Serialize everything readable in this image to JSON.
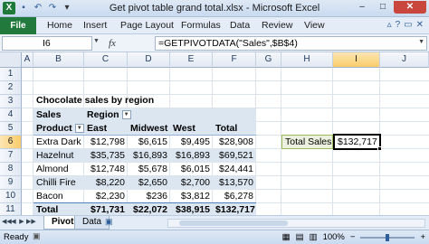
{
  "window": {
    "title": "Get pivot table grand total.xlsx - Microsoft Excel",
    "min": "–",
    "max": "□",
    "close": "✕"
  },
  "qat": {
    "logo": "X",
    "save": "▪",
    "undo": "↶",
    "redo": "↷",
    "more": "▾"
  },
  "ribbon": {
    "file": "File",
    "tabs": [
      "Home",
      "Insert",
      "Page Layout",
      "Formulas",
      "Data",
      "Review",
      "View"
    ],
    "help": "?"
  },
  "formula_bar": {
    "name_box": "I6",
    "fx": "fx",
    "formula": "=GETPIVOTDATA(\"Sales\",$B$4)"
  },
  "columns": [
    "A",
    "B",
    "C",
    "D",
    "E",
    "F",
    "G",
    "H",
    "I",
    "J"
  ],
  "rows": [
    "1",
    "2",
    "3",
    "4",
    "5",
    "6",
    "7",
    "8",
    "9",
    "10",
    "11",
    "12"
  ],
  "sheet": {
    "title": "Chocolate sales by region",
    "pivot": {
      "sales_label": "Sales",
      "region_label": "Region",
      "product_label": "Product",
      "headers": [
        "East",
        "Midwest",
        "West",
        "Total"
      ],
      "rows": [
        {
          "product": "Extra Dark",
          "values": [
            "$12,798",
            "$6,615",
            "$9,495",
            "$28,908"
          ]
        },
        {
          "product": "Hazelnut",
          "values": [
            "$35,735",
            "$16,893",
            "$16,893",
            "$69,521"
          ]
        },
        {
          "product": "Almond",
          "values": [
            "$12,748",
            "$5,678",
            "$6,015",
            "$24,441"
          ]
        },
        {
          "product": "Chilli Fire",
          "values": [
            "$8,220",
            "$2,650",
            "$2,700",
            "$13,570"
          ]
        },
        {
          "product": "Bacon",
          "values": [
            "$2,230",
            "$236",
            "$3,812",
            "$6,278"
          ]
        }
      ],
      "total_label": "Total",
      "totals": [
        "$71,731",
        "$22,072",
        "$38,915",
        "$132,717"
      ]
    },
    "total_sales_label": "Total Sales",
    "total_sales_value": "$132,717"
  },
  "sheet_tabs": {
    "tabs": [
      "Pivot",
      "Data"
    ],
    "active": "Pivot"
  },
  "status": {
    "ready": "Ready",
    "zoom": "100%",
    "minus": "−",
    "plus": "+"
  },
  "colors": {
    "file_tab": "#217a3c",
    "pivot_band": "#dce6f1",
    "total_sales_fill": "#ebf1de"
  }
}
